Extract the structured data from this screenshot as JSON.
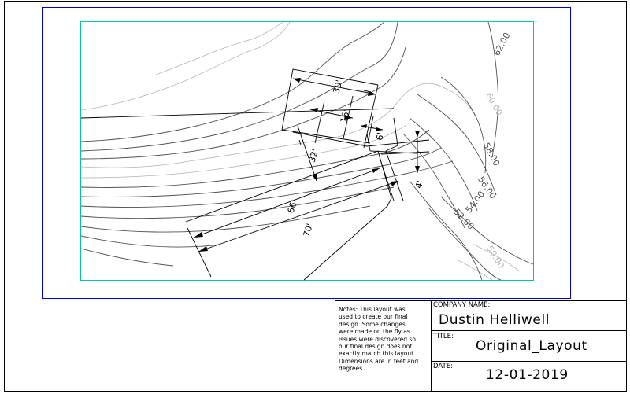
{
  "drawing": {
    "contour_labels": [
      "62.00",
      "60.00",
      "58.00",
      "56.00",
      "54.00",
      "52.00",
      "50.00"
    ],
    "dimension_labels": [
      "30'",
      "16'",
      "6'",
      "32'",
      "4'",
      "66'",
      "70'"
    ]
  },
  "title_block": {
    "notes": "Notes:  This layout was\nused to create our final\ndesign.  Some changes\nwere made on the fly as\nissues were discovered so\nour final design does not\nexactly match this layout.\nDimensions are in feet and\ndegrees.",
    "company_label": "COMPANY NAME:",
    "company_value": "Dustin Helliwell",
    "title_label": "TITLE:",
    "title_value": "Original_Layout",
    "date_label": "DATE:",
    "date_value": "12-01-2019"
  },
  "colors": {
    "viewport_border": "#0000cc",
    "drawing_frame": "#00c8a0",
    "contour_light": "#b4b4b4",
    "contour_dark": "#505050",
    "linework": "#000000"
  }
}
